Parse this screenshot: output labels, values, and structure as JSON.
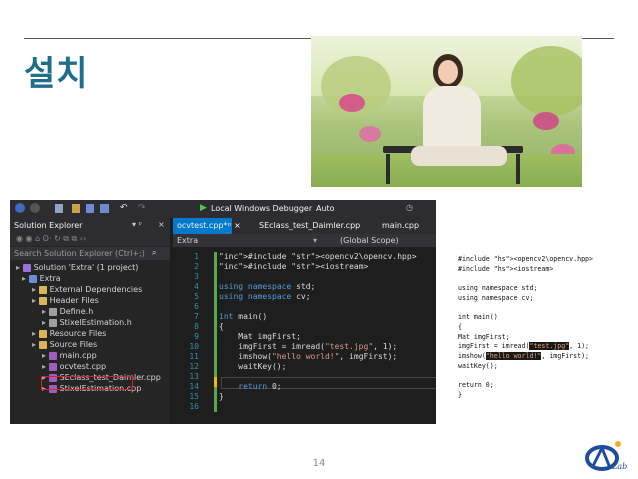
{
  "slide": {
    "title": "설치",
    "page_number": "14",
    "logo_text": "Lab"
  },
  "vs": {
    "toolbar": {
      "debugger_label": "Local Windows Debugger",
      "config_label": "Auto"
    },
    "solution_explorer": {
      "title": "Solution Explorer",
      "search_placeholder": "Search Solution Explorer (Ctrl+;)",
      "items": [
        {
          "label": "Solution 'Extra' (1 project)",
          "icon": "solution-icon"
        },
        {
          "label": "Extra",
          "icon": "project-icon"
        },
        {
          "label": "External Dependencies",
          "icon": "folder-icon"
        },
        {
          "label": "Header Files",
          "icon": "folder-icon"
        },
        {
          "label": "Define.h",
          "icon": "header-file-icon"
        },
        {
          "label": "StixelEstimation.h",
          "icon": "header-file-icon"
        },
        {
          "label": "Resource Files",
          "icon": "folder-icon"
        },
        {
          "label": "Source Files",
          "icon": "folder-icon"
        },
        {
          "label": "main.cpp",
          "icon": "cpp-file-icon"
        },
        {
          "label": "ocvtest.cpp",
          "icon": "cpp-file-icon",
          "highlighted": true
        },
        {
          "label": "SEclass_test_Daimler.cpp",
          "icon": "cpp-file-icon"
        },
        {
          "label": "StixelEstimation.cpp",
          "icon": "cpp-file-icon"
        }
      ]
    },
    "tabs": [
      {
        "label": "ocvtest.cpp*",
        "active": true
      },
      {
        "label": "SEclass_test_Daimler.cpp",
        "active": false
      },
      {
        "label": "main.cpp",
        "active": false
      }
    ],
    "nav": {
      "scope_left": "Extra",
      "scope_right": "(Global Scope)"
    },
    "line_numbers": [
      "1",
      "2",
      "3",
      "4",
      "5",
      "6",
      "7",
      "8",
      "9",
      "10",
      "11",
      "12",
      "13",
      "14",
      "15",
      "16"
    ],
    "code_lines": [
      "#include <opencv2\\opencv.hpp>",
      "#include <iostream>",
      "",
      "using namespace std;",
      "using namespace cv;",
      "",
      "int main()",
      "{",
      "    Mat imgFirst;",
      "    imgFirst = imread(\"test.jpg\", 1);",
      "    imshow(\"hello world!\", imgFirst);",
      "    waitKey();",
      "",
      "    return 0;",
      "}",
      ""
    ]
  },
  "right_code": [
    "#include <opencv2\\opencv.hpp>",
    "#include <iostream>",
    "",
    "using namespace std;",
    "using namespace cv;",
    "",
    "int main()",
    "{",
    "Mat imgFirst;",
    "imgFirst = imread(\"test.jpg\", 1);",
    "imshow(\"hello world!\", imgFirst);",
    "waitKey();",
    "",
    "return 0;",
    "}"
  ],
  "colors": {
    "title": "#1f6f8b",
    "vs_bg": "#1e1e1e",
    "keyword": "#569cd6",
    "string": "#d69d85",
    "highlight_box": "#e02020"
  }
}
